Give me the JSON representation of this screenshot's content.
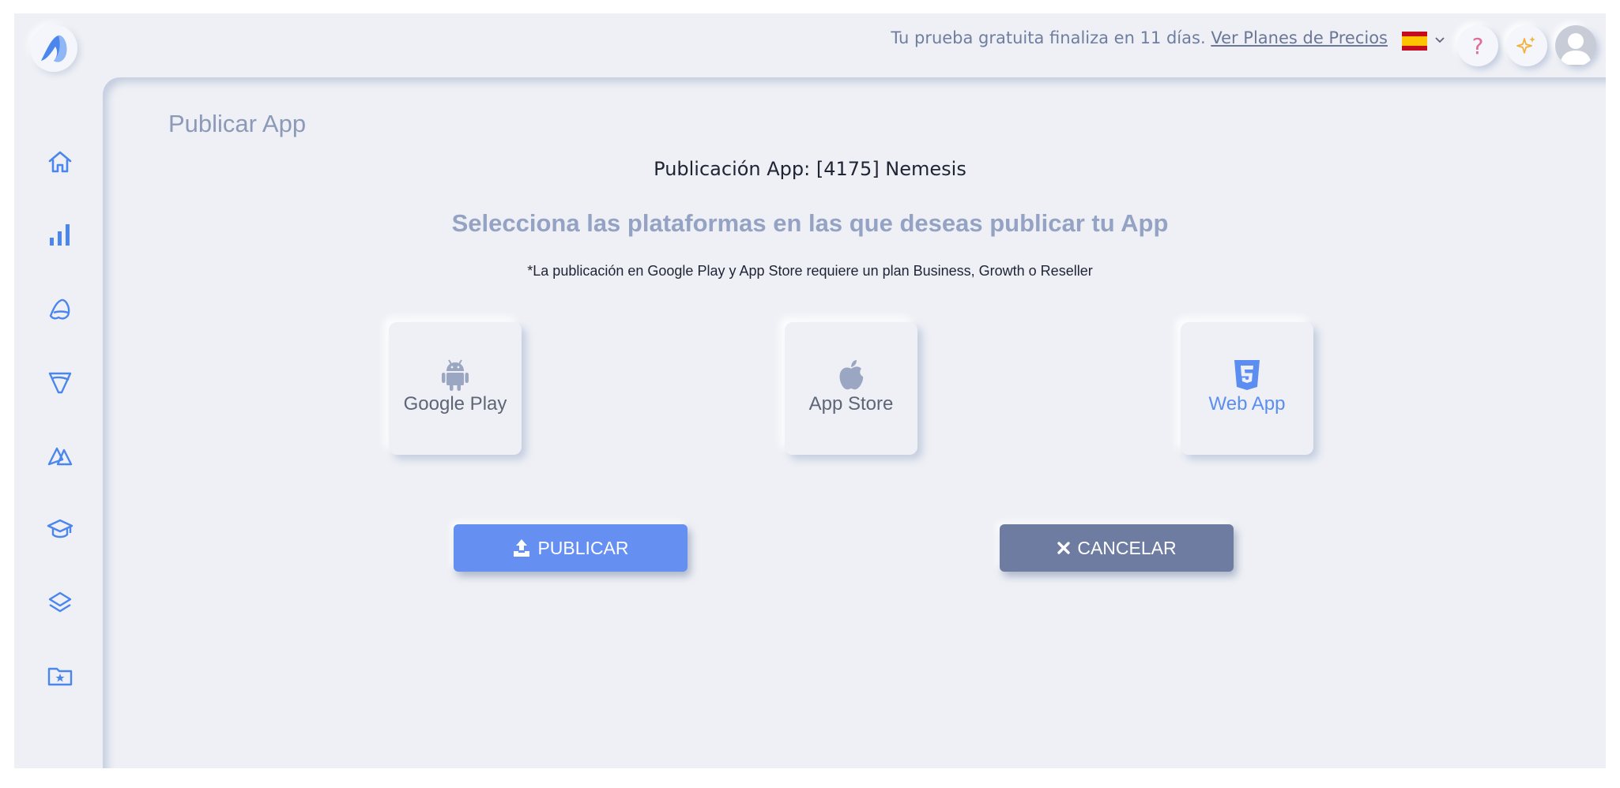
{
  "topbar": {
    "trial_text": "Tu prueba gratuita finaliza en 11 días.",
    "pricing_link": "Ver Planes de Precios",
    "help_label": "?",
    "language": "es"
  },
  "sidebar": {
    "items": [
      "home-icon",
      "bar-chart-icon",
      "app-builder-icon",
      "design-icon",
      "integrations-icon",
      "academy-icon",
      "layers-icon",
      "favorites-folder-icon"
    ]
  },
  "main": {
    "page_title": "Publicar App",
    "publication_label": "Publicación App:",
    "app_name": "[4175] Nemesis",
    "headline": "Selecciona las plataformas en las que deseas publicar tu App",
    "note": "*La publicación en Google Play y App Store requiere un plan Business, Growth o Reseller",
    "platforms": [
      {
        "label": "Google Play",
        "icon": "android-icon",
        "selected": false
      },
      {
        "label": "App Store",
        "icon": "apple-icon",
        "selected": false
      },
      {
        "label": "Web App",
        "icon": "html5-icon",
        "selected": true
      }
    ],
    "publish_button": "PUBLICAR",
    "cancel_button": "CANCELAR"
  },
  "colors": {
    "accent": "#658ff0",
    "cancel": "#6f7ca2",
    "background": "#eef0f5"
  }
}
